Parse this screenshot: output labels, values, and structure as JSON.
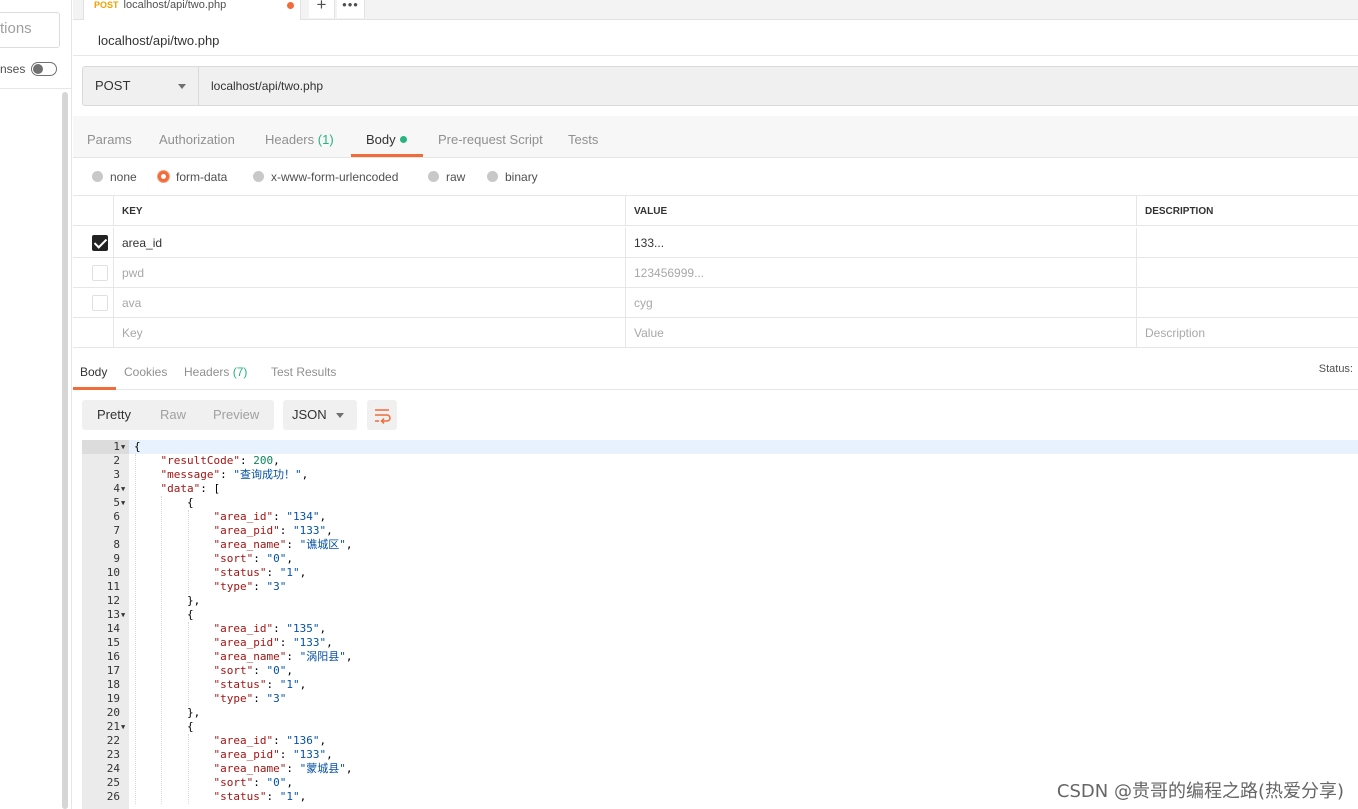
{
  "sidebar": {
    "partial_text": "tions",
    "toggle_label": "nses"
  },
  "tab": {
    "method": "POST",
    "url": "localhost/api/two.php",
    "add_label": "+",
    "more_label": "•••"
  },
  "request": {
    "title": "localhost/api/two.php",
    "method": "POST",
    "url": "localhost/api/two.php"
  },
  "request_tabs": [
    {
      "label": "Params"
    },
    {
      "label": "Authorization"
    },
    {
      "label": "Headers",
      "count": "(1)"
    },
    {
      "label": "Body"
    },
    {
      "label": "Pre-request Script"
    },
    {
      "label": "Tests"
    }
  ],
  "body_types": [
    "none",
    "form-data",
    "x-www-form-urlencoded",
    "raw",
    "binary"
  ],
  "form_table": {
    "headers": {
      "key": "KEY",
      "value": "VALUE",
      "description": "DESCRIPTION"
    },
    "rows": [
      {
        "key": "area_id",
        "value": "133...",
        "description": "",
        "checked": true
      },
      {
        "key": "pwd",
        "value": "123456999...",
        "description": "",
        "checked": false
      },
      {
        "key": "ava",
        "value": "cyg",
        "description": "",
        "checked": false
      }
    ],
    "placeholders": {
      "key": "Key",
      "value": "Value",
      "description": "Description"
    }
  },
  "response_tabs": [
    {
      "label": "Body"
    },
    {
      "label": "Cookies"
    },
    {
      "label": "Headers",
      "count": "(7)"
    },
    {
      "label": "Test Results"
    }
  ],
  "response_status_label": "Status:",
  "view_modes": [
    "Pretty",
    "Raw",
    "Preview"
  ],
  "format": "JSON",
  "code_lines": [
    "{",
    "    \"resultCode\": 200,",
    "    \"message\": \"查询成功！\",",
    "    \"data\": [",
    "        {",
    "            \"area_id\": \"134\",",
    "            \"area_pid\": \"133\",",
    "            \"area_name\": \"谯城区\",",
    "            \"sort\": \"0\",",
    "            \"status\": \"1\",",
    "            \"type\": \"3\"",
    "        },",
    "        {",
    "            \"area_id\": \"135\",",
    "            \"area_pid\": \"133\",",
    "            \"area_name\": \"涡阳县\",",
    "            \"sort\": \"0\",",
    "            \"status\": \"1\",",
    "            \"type\": \"3\"",
    "        },",
    "        {",
    "            \"area_id\": \"136\",",
    "            \"area_pid\": \"133\",",
    "            \"area_name\": \"蒙城县\",",
    "            \"sort\": \"0\",",
    "            \"status\": \"1\","
  ],
  "folds": [
    1,
    4,
    5,
    13,
    21
  ],
  "watermark": "CSDN @贵哥的编程之路(热爱分享)",
  "colors": {
    "accent": "#f26b3a",
    "count_green": "#26b47f",
    "method_orange": "#f0a000"
  }
}
